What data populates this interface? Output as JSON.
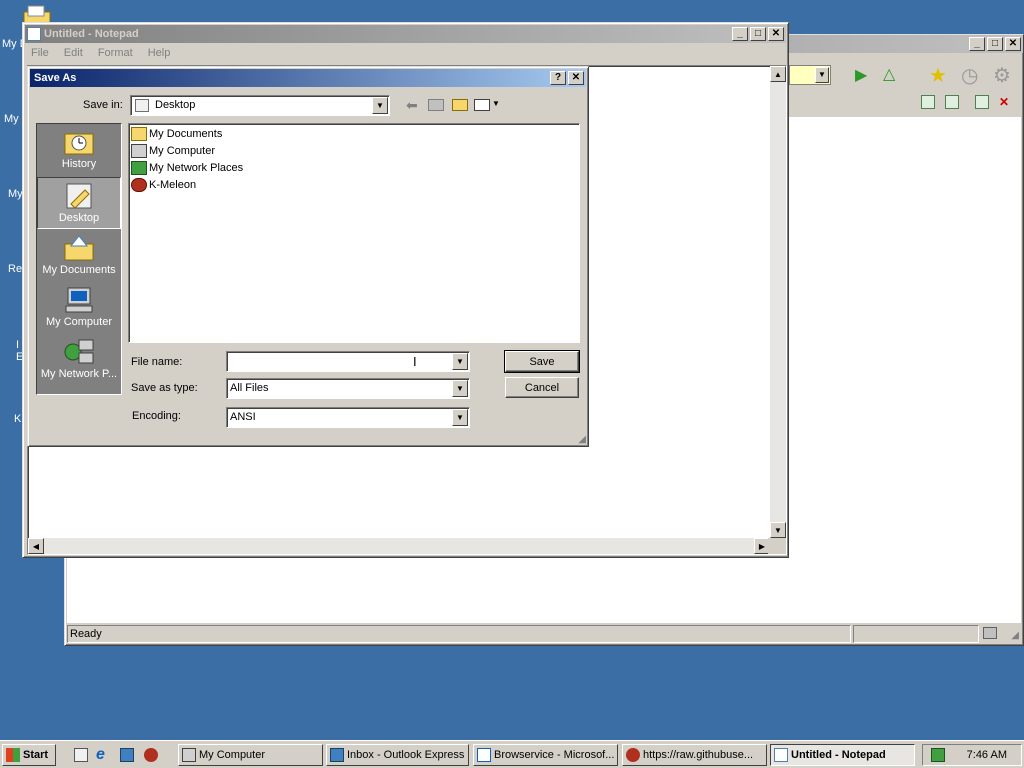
{
  "desktop": {
    "icons": [
      "My D",
      "My",
      "My",
      "Re",
      "I",
      "E",
      "K"
    ]
  },
  "browser": {
    "status": "Ready"
  },
  "notepad": {
    "title": "Untitled - Notepad",
    "menu": [
      "File",
      "Edit",
      "Format",
      "Help"
    ]
  },
  "dialog": {
    "title": "Save As",
    "help_btn": "?",
    "close_btn": "✕",
    "save_in_label": "Save in:",
    "save_in_value": "Desktop",
    "places": [
      {
        "label": "History"
      },
      {
        "label": "Desktop"
      },
      {
        "label": "My Documents"
      },
      {
        "label": "My Computer"
      },
      {
        "label": "My Network P..."
      }
    ],
    "files": [
      "My Documents",
      "My Computer",
      "My Network Places",
      "K-Meleon"
    ],
    "file_name_label": "File name:",
    "file_name_value": "",
    "save_as_type_label": "Save as type:",
    "save_as_type_value": "All Files",
    "encoding_label": "Encoding:",
    "encoding_value": "ANSI",
    "save_button": "Save",
    "cancel_button": "Cancel"
  },
  "taskbar": {
    "start": "Start",
    "tasks": [
      "My Computer",
      "Inbox - Outlook Express",
      "Browservice - Microsof...",
      "https://raw.githubuse...",
      "Untitled - Notepad"
    ],
    "clock": "7:46 AM"
  },
  "colors": {
    "desktop": "#3a6ea5",
    "active_title": "#0a246a",
    "face": "#d4d0c8"
  }
}
